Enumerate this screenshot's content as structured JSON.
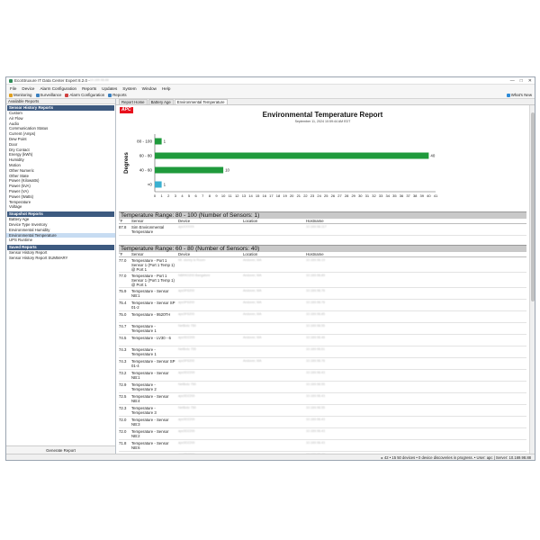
{
  "window": {
    "title": "EcoStruxure IT Data Center Expert 8.2.0 - ",
    "server_blur": "10.169.98.88",
    "controls": [
      "—",
      "□",
      "✕"
    ]
  },
  "menu": [
    "File",
    "Device",
    "Alarm Configuration",
    "Reports",
    "Updates",
    "System",
    "Window",
    "Help"
  ],
  "toolbar": {
    "buttons": [
      "Monitoring",
      "Surveillance",
      "Alarm Configuration",
      "Reports"
    ],
    "whats_new": "What's New"
  },
  "left_panel": {
    "header": "Available Reports",
    "sensor_history_title": "Sensor History Reports",
    "sensor_history_items": [
      "Custom",
      "Air Flow",
      "Audio",
      "Communication Status",
      "Current (Amps)",
      "Dew Point",
      "Door",
      "Dry Contact",
      "Energy (kWh)",
      "Humidity",
      "Motion",
      "Other Numeric",
      "Other State",
      "Power (Kilowatts)",
      "Power (kVA)",
      "Power (VA)",
      "Power (Watts)",
      "Temperature",
      "Voltage"
    ],
    "snapshot_title": "Snapshot Reports",
    "snapshot_items": [
      "Battery Age",
      "Device Type Inventory",
      "Environmental Humidity",
      "Environmental Temperature",
      "UPS Runtime"
    ],
    "saved_title": "Saved Reports",
    "saved_items": [
      "Sensor History Report",
      "Sensor History Report SUMMARY"
    ],
    "generate_button": "Generate Report"
  },
  "tabs": [
    "Report Home",
    "Battery Age",
    "Environmental Temperature"
  ],
  "report": {
    "logo": "APC",
    "title": "Environmental Temperature Report",
    "date": "September 11, 2024 10:59:44 AM EDT"
  },
  "chart_data": {
    "type": "bar",
    "orientation": "horizontal",
    "categories": [
      "80 - 100",
      "60 - 80",
      "40 - 60",
      "<0"
    ],
    "values": [
      1,
      40,
      10,
      1
    ],
    "colors": [
      "#1f9a3c",
      "#1f9a3c",
      "#1f9a3c",
      "#3ab0d0"
    ],
    "ylabel": "Degrees",
    "xlim": [
      0,
      41
    ],
    "xticks": [
      0,
      1,
      2,
      3,
      4,
      5,
      6,
      7,
      8,
      9,
      10,
      11,
      12,
      13,
      14,
      15,
      16,
      17,
      18,
      19,
      20,
      21,
      22,
      23,
      24,
      25,
      26,
      27,
      28,
      29,
      30,
      31,
      32,
      33,
      34,
      35,
      36,
      37,
      38,
      39,
      40,
      41
    ]
  },
  "table_cols": [
    "°F",
    "Sensor",
    "Device",
    "Location",
    "Hostname"
  ],
  "range1": {
    "header": "Temperature Range: 80 - 100 (Number of Sensors: 1)",
    "rows": [
      {
        "temp": "87.8",
        "sensor": "Sim Environmental Temperature",
        "device": "apcXXXXX",
        "location": "",
        "hostname": "10.169.98.117"
      }
    ]
  },
  "range2": {
    "header": "Temperature Range: 60 - 80 (Number of Sensors: 40)",
    "rows": [
      {
        "temp": "77.0",
        "sensor": "Temperature - Port 1 Sensor 1 (Port 1 Temp 1) @ Port 1",
        "device": "Mr. storey is Room",
        "location": "Andover, MA",
        "hostname": "10.169.98.19"
      },
      {
        "temp": "77.0",
        "sensor": "Temperature - Port 1 Sensor 1 (Port 1 Temp 1) @ Port 1",
        "device": "NBRK0200 Bangalore",
        "location": "Andover, MA",
        "hostname": "10.169.98.89"
      },
      {
        "temp": "75.9",
        "sensor": "Temperature - Sensor NB:1",
        "device": "apc0F6200",
        "location": "Andover, MA",
        "hostname": "10.169.98.76"
      },
      {
        "temp": "75.4",
        "sensor": "Temperature - Sensor SP 01-2",
        "device": "apc0F6200",
        "location": "Andover, MA",
        "hostname": "10.169.98.76"
      },
      {
        "temp": "75.0",
        "sensor": "Temperature - 9520TH",
        "device": "apc0F6200",
        "location": "Andover, MA",
        "hostname": "10.169.98.85"
      },
      {
        "temp": "74.7",
        "sensor": "Temperature - Temperature 1",
        "device": "NetBotz 750",
        "location": "",
        "hostname": "10.169.98.55"
      },
      {
        "temp": "74.5",
        "sensor": "Temperature - LV30 - 6",
        "device": "apc0D2200",
        "location": "Andover, MA",
        "hostname": "10.169.98.46"
      },
      {
        "temp": "74.3",
        "sensor": "Temperature - Temperature 1",
        "device": "NetBotz 755",
        "location": "",
        "hostname": "10.169.98.61"
      },
      {
        "temp": "74.3",
        "sensor": "Temperature - Sensor SP 01-4",
        "device": "apc0F6200",
        "location": "Andover, MA",
        "hostname": "10.169.98.76"
      },
      {
        "temp": "73.2",
        "sensor": "Temperature - Sensor NB:1",
        "device": "apc0D2200",
        "location": "",
        "hostname": "10.169.98.43"
      },
      {
        "temp": "72.9",
        "sensor": "Temperature - Temperature 2",
        "device": "NetBotz 750",
        "location": "",
        "hostname": "10.169.98.55"
      },
      {
        "temp": "72.5",
        "sensor": "Temperature - Sensor NB:4",
        "device": "apc0D2200",
        "location": "",
        "hostname": "10.169.98.43"
      },
      {
        "temp": "72.3",
        "sensor": "Temperature - Temperature 3",
        "device": "NetBotz 750",
        "location": "",
        "hostname": "10.169.98.55"
      },
      {
        "temp": "72.0",
        "sensor": "Temperature - Sensor NB:3",
        "device": "apc0D2200",
        "location": "",
        "hostname": "10.169.98.43"
      },
      {
        "temp": "72.0",
        "sensor": "Temperature - Sensor NB:2",
        "device": "apc0D2200",
        "location": "",
        "hostname": "10.169.98.43"
      },
      {
        "temp": "71.8",
        "sensor": "Temperature - Sensor NB:6",
        "device": "apc0D2200",
        "location": "",
        "hostname": "10.169.98.43"
      },
      {
        "temp": "71.6",
        "sensor": "Temperature - Sensor NB:5",
        "device": "apc0D2200",
        "location": "",
        "hostname": "10.169.98.43"
      },
      {
        "temp": "70.9",
        "sensor": "Temperature - Temperature 4",
        "device": "NetBotz 750",
        "location": "",
        "hostname": "10.169.98.55"
      }
    ]
  },
  "status": "▸ 42 • 15 50 devices • 0 device discoveries in progress. • User: apc | Server: 10.169.98.88"
}
